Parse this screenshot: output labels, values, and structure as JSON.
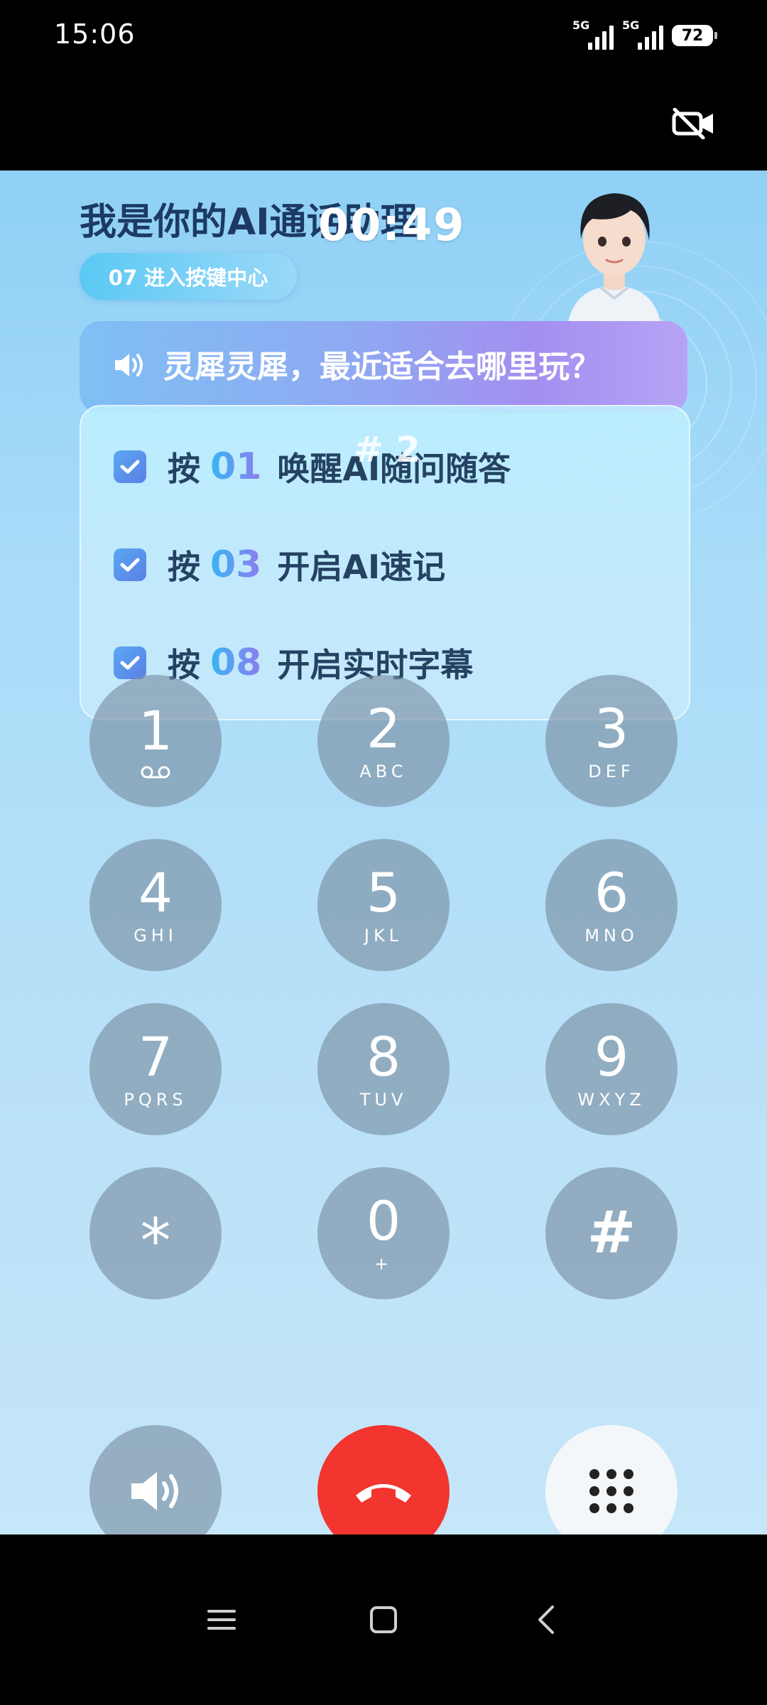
{
  "status_bar": {
    "time": "15:06",
    "network_1": "5G",
    "network_2": "5G",
    "battery": "72"
  },
  "call": {
    "assistant_title": "我是你的AI通话助理",
    "timer": "00:49",
    "key_center_label": "07 进入按键中心",
    "question": "灵犀灵犀，最近适合去哪里玩？",
    "dtmf_echo": "# 2",
    "options": [
      {
        "press": "按",
        "code": "01",
        "text": "唤醒AI随问随答"
      },
      {
        "press": "按",
        "code": "03",
        "text": "开启AI速记"
      },
      {
        "press": "按",
        "code": "08",
        "text": "开启实时字幕"
      }
    ]
  },
  "keypad": [
    {
      "digit": "1",
      "letters": ""
    },
    {
      "digit": "2",
      "letters": "ABC"
    },
    {
      "digit": "3",
      "letters": "DEF"
    },
    {
      "digit": "4",
      "letters": "GHI"
    },
    {
      "digit": "5",
      "letters": "JKL"
    },
    {
      "digit": "6",
      "letters": "MNO"
    },
    {
      "digit": "7",
      "letters": "PQRS"
    },
    {
      "digit": "8",
      "letters": "TUV"
    },
    {
      "digit": "9",
      "letters": "WXYZ"
    },
    {
      "digit": "*",
      "letters": ""
    },
    {
      "digit": "0",
      "letters": "+"
    },
    {
      "digit": "#",
      "letters": ""
    }
  ],
  "icons": {
    "video_off": "video-off-icon",
    "speaker": "speaker-icon",
    "hangup": "hangup-icon",
    "keypad": "dialpad-icon",
    "voicemail": "voicemail-icon",
    "nav_menu": "menu-icon",
    "nav_home": "home-icon",
    "nav_back": "back-icon"
  },
  "colors": {
    "hangup": "#f2352e",
    "accent": "#5bc9f4"
  }
}
